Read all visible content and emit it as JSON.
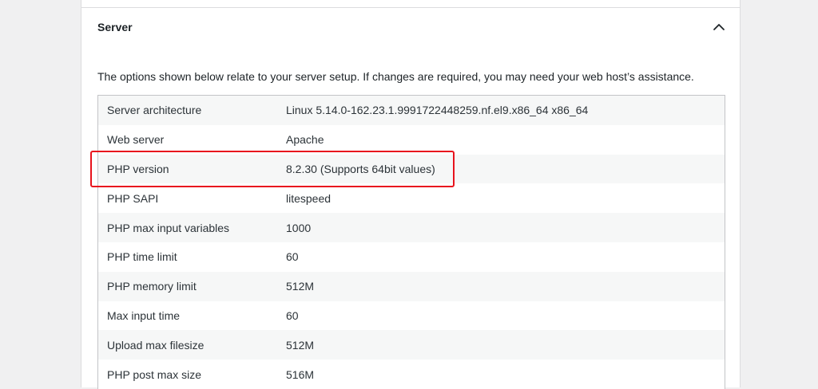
{
  "section": {
    "title": "Server",
    "toggle_icon": "chevron-up-icon",
    "description": "The options shown below relate to your server setup. If changes are required, you may need your web host’s assistance."
  },
  "rows": [
    {
      "label": "Server architecture",
      "value": "Linux 5.14.0-162.23.1.9991722448259.nf.el9.x86_64 x86_64"
    },
    {
      "label": "Web server",
      "value": "Apache"
    },
    {
      "label": "PHP version",
      "value": "8.2.30 (Supports 64bit values)"
    },
    {
      "label": "PHP SAPI",
      "value": "litespeed"
    },
    {
      "label": "PHP max input variables",
      "value": "1000"
    },
    {
      "label": "PHP time limit",
      "value": "60"
    },
    {
      "label": "PHP memory limit",
      "value": "512M"
    },
    {
      "label": "Max input time",
      "value": "60"
    },
    {
      "label": "Upload max filesize",
      "value": "512M"
    },
    {
      "label": "PHP post max size",
      "value": "516M"
    }
  ],
  "colors": {
    "highlight": "#e8131d",
    "row_alt": "#f6f7f7",
    "background": "#f0f0f1"
  }
}
